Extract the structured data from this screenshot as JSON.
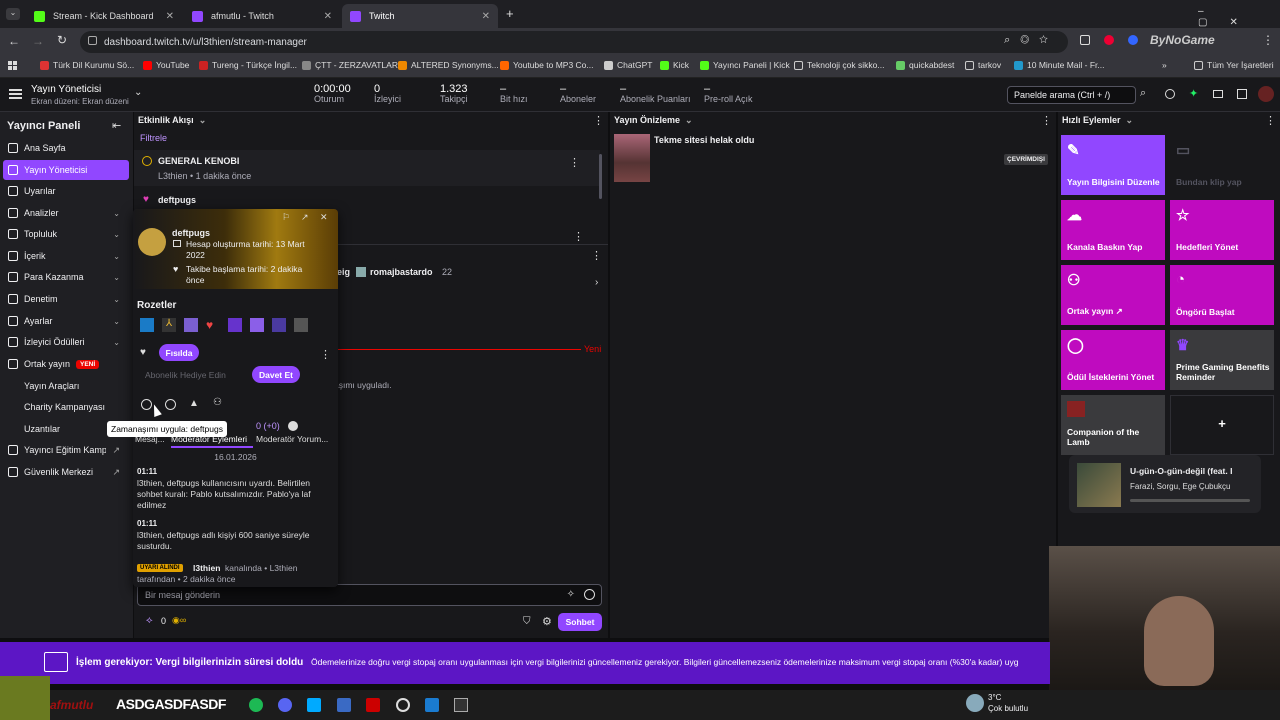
{
  "browser": {
    "tabs": [
      {
        "title": "Stream - Kick Dashboard",
        "color": "#53fc18"
      },
      {
        "title": "afmutlu - Twitch",
        "color": "#9147ff"
      },
      {
        "title": "Twitch",
        "color": "#9147ff"
      }
    ],
    "new_tab": "+",
    "url": "dashboard.twitch.tv/u/l3thien/stream-manager",
    "bookmarks": [
      "Türk Dil Kurumu Sö...",
      "YouTube",
      "Tureng - Türkçe İngil...",
      "ÇTT - ZERZAVATLAR",
      "ALTERED Synonyms...",
      "Youtube to MP3 Co...",
      "ChatGPT",
      "Kick",
      "Yayıncı Paneli | Kick",
      "Teknoloji çok sikko...",
      "quickabdest",
      "tarkov",
      "10 Minute Mail - Fr..."
    ],
    "bookmarks_more": "»",
    "all_bookmarks": "Tüm Yer İşaretleri",
    "profile_overlay": "ByNoGame"
  },
  "header": {
    "title": "Yayın Yöneticisi",
    "subtitle": "Ekran düzeni: Ekran düzeni 1",
    "stats": [
      {
        "value": "0:00:00",
        "label": "Oturum"
      },
      {
        "value": "0",
        "label": "İzleyici"
      },
      {
        "value": "1.323",
        "label": "Takipçi"
      },
      {
        "value": "–",
        "label": "Bit hızı"
      },
      {
        "value": "–",
        "label": "Aboneler"
      },
      {
        "value": "–",
        "label": "Abonelik Puanları"
      },
      {
        "value": "–",
        "label": "Pre-roll Açık"
      }
    ],
    "search_placeholder": "Panelde arama (Ctrl + /)"
  },
  "sidebar": {
    "title": "Yayıncı Paneli",
    "items": [
      {
        "label": "Ana Sayfa"
      },
      {
        "label": "Yayın Yöneticisi"
      },
      {
        "label": "Uyarılar"
      },
      {
        "label": "Analizler"
      },
      {
        "label": "Topluluk"
      },
      {
        "label": "İçerik"
      },
      {
        "label": "Para Kazanma"
      },
      {
        "label": "Denetim"
      },
      {
        "label": "Ayarlar"
      },
      {
        "label": "İzleyici Ödülleri"
      },
      {
        "label": "Ortak yayın"
      },
      {
        "label": "Yayın Araçları"
      },
      {
        "label": "Charity Kampanyası"
      },
      {
        "label": "Uzantılar"
      },
      {
        "label": "Yayıncı Eğitim Kampı"
      },
      {
        "label": "Güvenlik Merkezi"
      }
    ],
    "new_badge": "YENİ"
  },
  "activity": {
    "title": "Etkinlik Akışı",
    "filter": "Filtrele",
    "items": [
      {
        "name": "GENERAL KENOBI",
        "sub": "L3thien • 1 dakika önce"
      },
      {
        "name": "deftpugs"
      }
    ],
    "chat_names": [
      "eig",
      "romajbastardo",
      "22"
    ]
  },
  "usercard": {
    "username": "deftpugs",
    "created": "Hesap oluşturma tarihi: 13 Mart 2022",
    "followed": "Takibe başlama tarihi: 2 dakika önce",
    "badges_title": "Rozetler",
    "whisper": "Fısılda",
    "gift": "Abonelik Hediye Edin",
    "invite": "Davet Et",
    "tooltip": "Zamanaşımı uygula: deftpugs",
    "tabs": [
      "Mesaj...",
      "Moderatör Eylemleri",
      "Moderatör Yorum..."
    ],
    "count": "0 (+0)",
    "date": "16.01.2026",
    "logs": [
      {
        "time": "01:11",
        "text": "l3thien, deftpugs kullanıcısını uyardı. Belirtilen sohbet kuralı: Pablo kutsalımızdır. Pablo'ya laf edilmez"
      },
      {
        "time": "01:11",
        "text": "l3thien, deftpugs adlı kişiyi 600 saniye süreyle susturdu."
      }
    ],
    "warn_badge": "UYARI ALINDI",
    "warn_text_name": "l3thien",
    "warn_text_rest": "kanalında • L3thien tarafından • 2 dakika önce"
  },
  "chat": {
    "new_label": "Yeni",
    "line1": "aşımı uyguladı.",
    "placeholder": "Bir mesaj gönderin",
    "points": "0",
    "send": "Sohbet"
  },
  "preview": {
    "title": "Yayın Önizleme",
    "stream_title": "Tekme sitesi helak oldu",
    "offline": "ÇEVRİMDIŞI"
  },
  "quick": {
    "title": "Hızlı Eylemler",
    "tiles": [
      {
        "label": "Yayın Bilgisini Düzenle"
      },
      {
        "label": "Bundan klip yap"
      },
      {
        "label": "Kanala Baskın Yap"
      },
      {
        "label": "Hedefleri Yönet"
      },
      {
        "label": "Ortak yayın ↗"
      },
      {
        "label": "Öngörü Başlat"
      },
      {
        "label": "Ödül İsteklerini Yönet"
      },
      {
        "label": "Prime Gaming Benefits Reminder"
      },
      {
        "label": "Companion of the Lamb"
      },
      {
        "label": "+"
      }
    ],
    "tile_color": "#bf0bbf",
    "song": {
      "title": "U-gün-O-gün-değil (feat. I",
      "artist": "Farazi, Sorgu, Ege Çubukçu"
    }
  },
  "banner": {
    "bold": "İşlem gerekiyor: Vergi bilgilerinizin süresi doldu",
    "text": "Ödemelerinize doğru vergi stopaj oranı uygulanması için vergi bilgilerinizi güncellemeniz gerekiyor. Bilgileri güncellemezseniz ödemelerinize maksimum vergi stopaj oranı (%30'a kadar) uyg"
  },
  "taskbar": {
    "overlay_text": "ASDGASDFASDF",
    "overlay_name": "afmutlu",
    "weather_temp": "3°C",
    "weather_desc": "Çok bulutlu"
  }
}
